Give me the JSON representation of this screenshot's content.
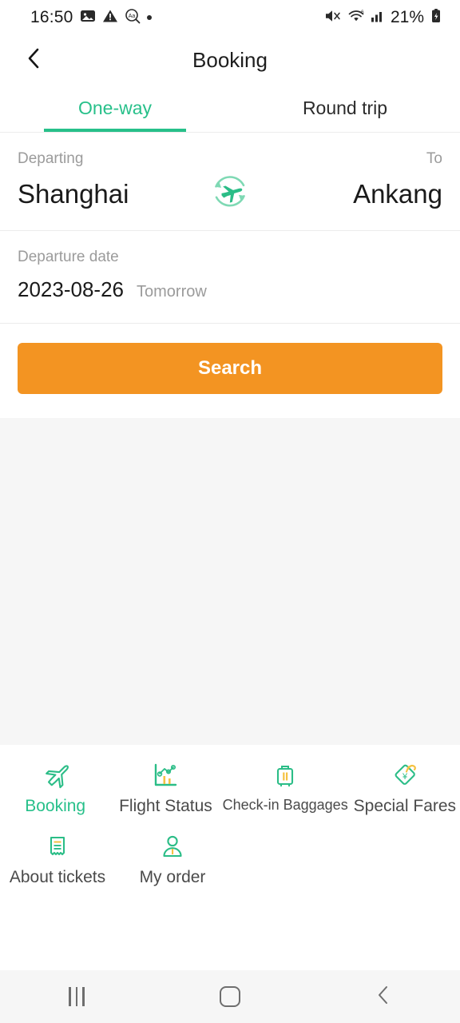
{
  "status_bar": {
    "time": "16:50",
    "battery_percent": "21%",
    "icons": [
      "image-icon",
      "warning-icon",
      "text-magnifier-icon",
      "dot-icon",
      "mute-icon",
      "wifi-6-icon",
      "signal-bars-icon",
      "battery-charging-icon"
    ]
  },
  "app_bar": {
    "title": "Booking",
    "back_icon": "chevron-left-icon"
  },
  "tabs": [
    {
      "label": "One-way",
      "active": true
    },
    {
      "label": "Round trip",
      "active": false
    }
  ],
  "route": {
    "departing_label": "Departing",
    "to_label": "To",
    "departing_city": "Shanghai",
    "to_city": "Ankang",
    "swap_icon": "swap-plane-icon"
  },
  "date": {
    "label": "Departure date",
    "value": "2023-08-26",
    "relative": "Tomorrow"
  },
  "search": {
    "label": "Search"
  },
  "menu": {
    "row1": [
      {
        "label": "Booking",
        "icon": "plane-icon",
        "active": true,
        "small": false
      },
      {
        "label": "Flight Status",
        "icon": "chart-icon",
        "active": false,
        "small": false
      },
      {
        "label": "Check-in Baggages",
        "icon": "suitcase-icon",
        "active": false,
        "small": true
      },
      {
        "label": "Special Fares",
        "icon": "price-tag-icon",
        "active": false,
        "small": false
      }
    ],
    "row2": [
      {
        "label": "About tickets",
        "icon": "receipt-icon",
        "active": false,
        "small": false
      },
      {
        "label": "My order",
        "icon": "person-icon",
        "active": false,
        "small": false
      }
    ]
  },
  "nav_bar": {
    "recents": "recents-icon",
    "home": "home-icon",
    "back": "back-icon"
  },
  "colors": {
    "accent_green": "#27c08a",
    "accent_orange": "#f39422",
    "icon_yellow": "#f5c242",
    "text_dark": "#1a1a1a",
    "text_muted": "#9b9b9b",
    "surface_gray": "#f6f6f6"
  }
}
